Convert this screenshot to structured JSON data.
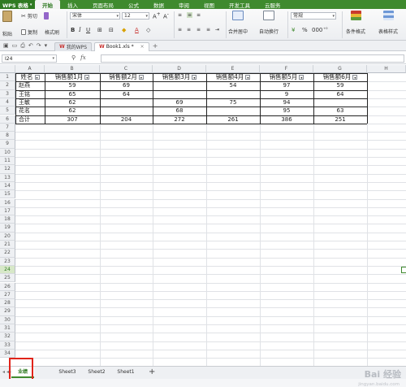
{
  "menubar": {
    "app_label": "WPS 表格",
    "tabs": [
      "开始",
      "插入",
      "页面布局",
      "公式",
      "数据",
      "审阅",
      "视图",
      "开发工具",
      "云服务"
    ],
    "active_tab": "开始"
  },
  "ribbon": {
    "paste_label": "粘贴",
    "cut_label": "剪切",
    "copy_label": "复制",
    "format_painter_label": "格式刷",
    "font_name": "宋体",
    "font_size": "12",
    "merge_label": "合并居中",
    "wrap_label": "自动换行",
    "number_format": "常规",
    "cond_format_label": "条件格式",
    "table_style_label": "表格样式"
  },
  "docbar": {
    "tabs": [
      {
        "label": "我的WPS",
        "active": false
      },
      {
        "label": "Book1.xls *",
        "active": true
      }
    ]
  },
  "formula_bar": {
    "name_box": "I24",
    "fx_label": "fx",
    "value": ""
  },
  "grid": {
    "columns": [
      "A",
      "B",
      "C",
      "D",
      "E",
      "F",
      "G",
      "H"
    ],
    "row_count": 34,
    "selected_row": 24,
    "headers": [
      "姓名",
      "销售额1月",
      "销售额2月",
      "销售额3月",
      "销售额4月",
      "销售额5月",
      "销售额6月"
    ],
    "rows": [
      [
        "赵燕",
        "59",
        "69",
        "",
        "54",
        "97",
        "59"
      ],
      [
        "王铭",
        "65",
        "64",
        "",
        "",
        "9",
        "64"
      ],
      [
        "王敏",
        "62",
        "",
        "69",
        "75",
        "94",
        ""
      ],
      [
        "花名",
        "62",
        "",
        "68",
        "",
        "95",
        "63"
      ],
      [
        "合计",
        "307",
        "204",
        "272",
        "261",
        "386",
        "251"
      ]
    ]
  },
  "sheet_tabs": {
    "tabs": [
      "业绩",
      "Sheet3",
      "Sheet2",
      "Sheet1"
    ],
    "active": "业绩",
    "add_label": "+"
  },
  "watermark": {
    "text": "Bai 经验",
    "url": "jingyan.baidu.com"
  },
  "colors": {
    "accent": "#3f8a2e",
    "highlight_box": "#e0241a"
  }
}
